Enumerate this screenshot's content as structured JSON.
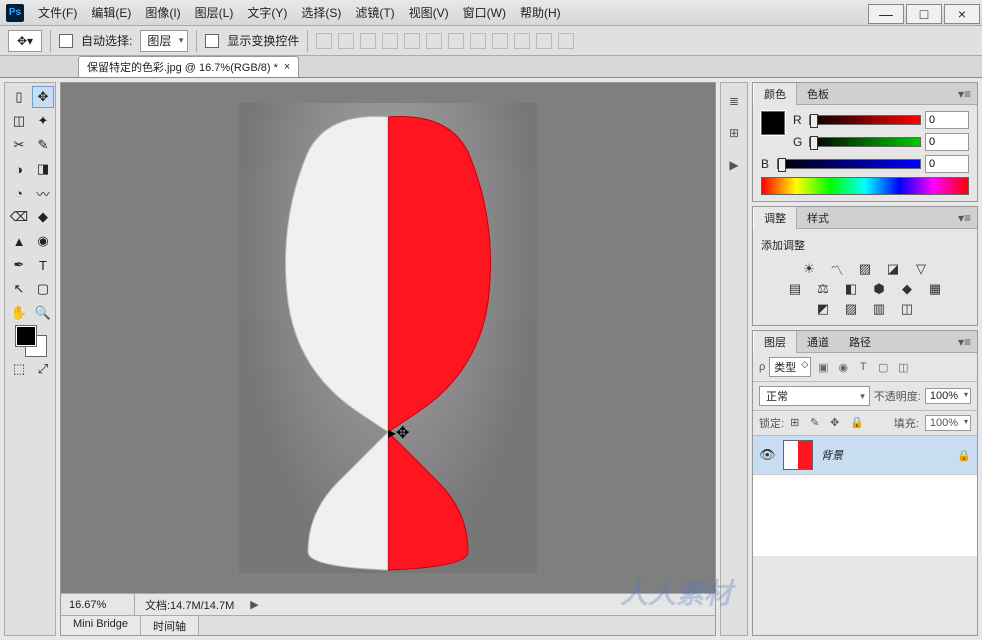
{
  "app": {
    "name": "Ps"
  },
  "menu": [
    "文件(F)",
    "编辑(E)",
    "图像(I)",
    "图层(L)",
    "文字(Y)",
    "选择(S)",
    "滤镜(T)",
    "视图(V)",
    "窗口(W)",
    "帮助(H)"
  ],
  "winControls": {
    "min": "—",
    "max": "□",
    "close": "×"
  },
  "options": {
    "autoSelect": "自动选择:",
    "targetSelect": "图层",
    "showTransform": "显示变换控件"
  },
  "docTab": {
    "title": "保留特定的色彩.jpg @ 16.7%(RGB/8) *",
    "close": "×"
  },
  "status": {
    "zoom": "16.67%",
    "doc": "文档:14.7M/14.7M"
  },
  "bottomTabs": [
    "Mini Bridge",
    "时间轴"
  ],
  "toolbox": [
    "▯",
    "✥",
    "◫",
    "✦",
    "✂",
    "✎",
    "◑",
    "◨",
    "◔",
    "〰",
    "⌫",
    "◆",
    "▲",
    "◉",
    "✒",
    "T",
    "↖",
    "▢",
    "✋",
    "🔍"
  ],
  "toolWideIcons": [
    "⬚",
    "⤢"
  ],
  "dockIcons": [
    "≣",
    "⊞",
    "▶"
  ],
  "panels": {
    "color": {
      "tabs": [
        "颜色",
        "色板"
      ],
      "channels": [
        {
          "label": "R",
          "class": "slider-r",
          "value": "0"
        },
        {
          "label": "G",
          "class": "slider-g",
          "value": "0"
        },
        {
          "label": "B",
          "class": "slider-b",
          "value": "0"
        }
      ]
    },
    "adjust": {
      "tabs": [
        "调整",
        "样式"
      ],
      "title": "添加调整",
      "icons_row1": [
        "☀",
        "〽",
        "▨",
        "◪",
        "▽"
      ],
      "icons_row2": [
        "▤",
        "⚖",
        "◧",
        "⬢",
        "◆",
        "▦"
      ],
      "icons_row3": [
        "◩",
        "▨",
        "▥",
        "◫"
      ]
    },
    "layers": {
      "tabs": [
        "图层",
        "通道",
        "路径"
      ],
      "kind": "类型",
      "filterIcons": [
        "▣",
        "◉",
        "T",
        "▢",
        "◫"
      ],
      "blend": "正常",
      "opacityLabel": "不透明度:",
      "opacity": "100%",
      "lockLabel": "锁定:",
      "lockIcons": [
        "⊞",
        "✎",
        "✥",
        "🔒"
      ],
      "fillLabel": "填充:",
      "fill": "100%",
      "layer": {
        "name": "背景",
        "locked": "🔒"
      }
    }
  },
  "watermark": "人人素材"
}
